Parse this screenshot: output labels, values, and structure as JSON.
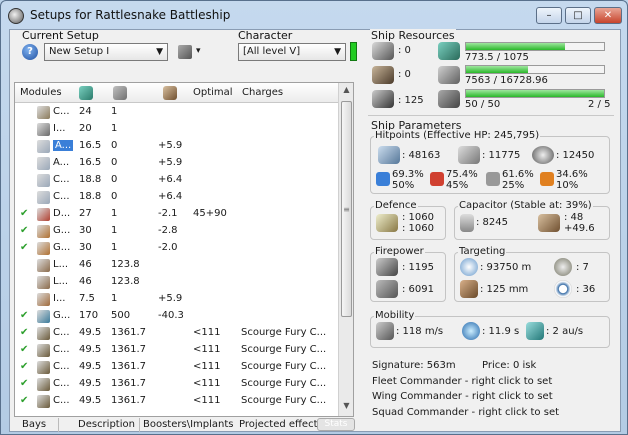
{
  "window": {
    "title": "Setups for Rattlesnake Battleship",
    "min": "–",
    "max": "□",
    "close": "✕"
  },
  "setup": {
    "label": "Current Setup",
    "value": "New Setup I"
  },
  "character": {
    "label": "Character",
    "value": "[All level V]"
  },
  "table": {
    "headers": [
      "Modules",
      "",
      "",
      "",
      "Optimal",
      "Charges"
    ],
    "rows": [
      {
        "checked": false,
        "name": "C...",
        "a": "24",
        "b": "1",
        "c": "",
        "opt": "",
        "charge": "",
        "icon": "#8a7a5a"
      },
      {
        "checked": false,
        "name": "I...",
        "a": "20",
        "b": "1",
        "c": "",
        "opt": "",
        "charge": "",
        "icon": "#6a6a6a"
      },
      {
        "checked": false,
        "name": "A...",
        "a": "16.5",
        "b": "0",
        "c": "+5.9",
        "opt": "",
        "charge": "",
        "icon": "#9aa8b8",
        "selected": true
      },
      {
        "checked": false,
        "name": "A...",
        "a": "16.5",
        "b": "0",
        "c": "+5.9",
        "opt": "",
        "charge": "",
        "icon": "#9aa8b8"
      },
      {
        "checked": false,
        "name": "C...",
        "a": "18.8",
        "b": "0",
        "c": "+6.4",
        "opt": "",
        "charge": "",
        "icon": "#9aa8b8"
      },
      {
        "checked": false,
        "name": "C...",
        "a": "18.8",
        "b": "0",
        "c": "+6.4",
        "opt": "",
        "charge": "",
        "icon": "#9aa8b8"
      },
      {
        "checked": true,
        "name": "D...",
        "a": "27",
        "b": "1",
        "c": "-2.1",
        "opt": "45+90",
        "charge": "",
        "icon": "#b04030"
      },
      {
        "checked": true,
        "name": "G...",
        "a": "30",
        "b": "1",
        "c": "-2.8",
        "opt": "",
        "charge": "",
        "icon": "#b07030"
      },
      {
        "checked": true,
        "name": "G...",
        "a": "30",
        "b": "1",
        "c": "-2.0",
        "opt": "",
        "charge": "",
        "icon": "#b07030"
      },
      {
        "checked": false,
        "name": "L...",
        "a": "46",
        "b": "123.8",
        "c": "",
        "opt": "",
        "charge": "",
        "icon": "#8a6a4a"
      },
      {
        "checked": false,
        "name": "L...",
        "a": "46",
        "b": "123.8",
        "c": "",
        "opt": "",
        "charge": "",
        "icon": "#8a6a4a"
      },
      {
        "checked": false,
        "name": "I...",
        "a": "7.5",
        "b": "1",
        "c": "+5.9",
        "opt": "",
        "charge": "",
        "icon": "#a06a3a"
      },
      {
        "checked": true,
        "name": "G...",
        "a": "170",
        "b": "500",
        "c": "-40.3",
        "opt": "",
        "charge": "",
        "icon": "#3a7a9a"
      },
      {
        "checked": true,
        "name": "C...",
        "a": "49.5",
        "b": "1361.7",
        "c": "",
        "opt": "<111",
        "charge": "Scourge Fury C...",
        "icon": "#6a5a3a"
      },
      {
        "checked": true,
        "name": "C...",
        "a": "49.5",
        "b": "1361.7",
        "c": "",
        "opt": "<111",
        "charge": "Scourge Fury C...",
        "icon": "#6a5a3a"
      },
      {
        "checked": true,
        "name": "C...",
        "a": "49.5",
        "b": "1361.7",
        "c": "",
        "opt": "<111",
        "charge": "Scourge Fury C...",
        "icon": "#6a5a3a"
      },
      {
        "checked": true,
        "name": "C...",
        "a": "49.5",
        "b": "1361.7",
        "c": "",
        "opt": "<111",
        "charge": "Scourge Fury C...",
        "icon": "#6a5a3a"
      },
      {
        "checked": true,
        "name": "C...",
        "a": "49.5",
        "b": "1361.7",
        "c": "",
        "opt": "<111",
        "charge": "Scourge Fury C...",
        "icon": "#6a5a3a"
      }
    ]
  },
  "bottom_tabs": [
    "Bays",
    "Description",
    "Boosters\\Implants",
    "Projected effects",
    "Stats"
  ],
  "resources": {
    "title": "Ship Resources",
    "hi": ": 0",
    "med": ": 0",
    "low": ": 125",
    "cpu": "773.5 / 1075",
    "cpu_fill": 0.72,
    "pg": "7563 / 16728.96",
    "pg_fill": 0.45,
    "drone": "50 / 50",
    "drone_fill": 1.0,
    "turrets": "2 / 5"
  },
  "params": {
    "title": "Ship Parameters",
    "hitpoints_title": "Hitpoints (Effective HP: 245,795)",
    "shield_hp": ": 48163",
    "armor_hp": ": 11775",
    "hull_hp": ": 12450",
    "res1a": "69.3%",
    "res1b": "50%",
    "res2a": "75.4%",
    "res2b": "45%",
    "res3a": "61.6%",
    "res3b": "25%",
    "res4a": "34.6%",
    "res4b": "10%",
    "defence_title": "Defence",
    "def1": ": 1060",
    "def2": ": 1060",
    "cap_title": "Capacitor (Stable at: 39%)",
    "cap_amount": ": 8245",
    "cap_a": ": 48",
    "cap_b": "+49.6",
    "fire_title": "Firepower",
    "fire1": ": 1195",
    "fire2": ": 6091",
    "tgt_title": "Targeting",
    "tgt_range": ": 93750 m",
    "tgt_count": ": 7",
    "tgt_res": ": 125 mm",
    "tgt_sig": ": 36",
    "mob_title": "Mobility",
    "speed": ": 118 m/s",
    "align": ": 11.9 s",
    "warp": ": 2 au/s",
    "signature": "Signature: 563m",
    "price": "Price: 0 isk",
    "fleet": "Fleet Commander - right click to set",
    "wing": "Wing Commander - right click to set",
    "squad": "Squad Commander - right click to set"
  },
  "colors": {
    "accent": "#3a7fd8",
    "ok": "#2ea02e",
    "bar": "#2ab82a"
  }
}
